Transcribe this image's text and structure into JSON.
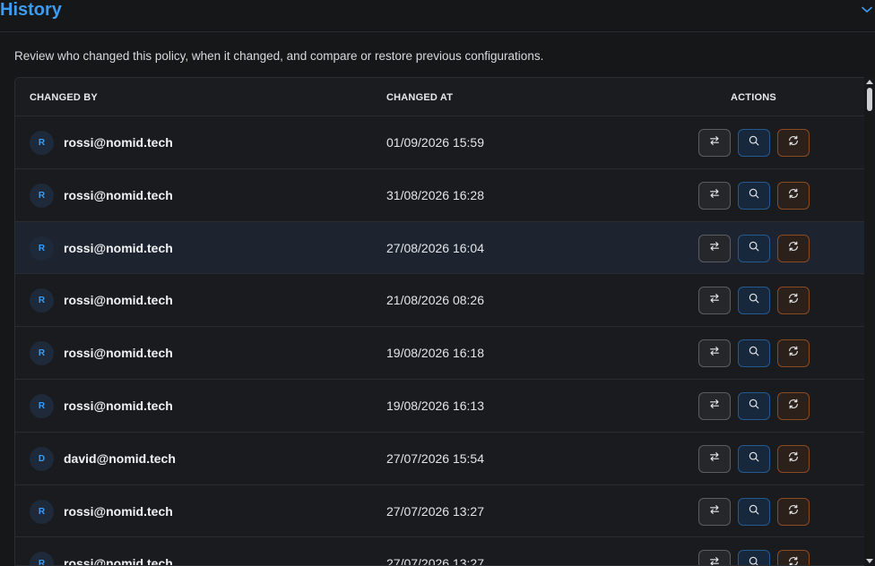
{
  "section": {
    "title": "History",
    "description": "Review who changed this policy, when it changed, and compare or restore previous configurations."
  },
  "table": {
    "headers": {
      "changed_by": "CHANGED BY",
      "changed_at": "CHANGED AT",
      "actions": "ACTIONS"
    },
    "rows": [
      {
        "initial": "R",
        "user": "rossi@nomid.tech",
        "changed_at": "01/09/2026 15:59"
      },
      {
        "initial": "R",
        "user": "rossi@nomid.tech",
        "changed_at": "31/08/2026 16:28"
      },
      {
        "initial": "R",
        "user": "rossi@nomid.tech",
        "changed_at": "27/08/2026 16:04"
      },
      {
        "initial": "R",
        "user": "rossi@nomid.tech",
        "changed_at": "21/08/2026 08:26"
      },
      {
        "initial": "R",
        "user": "rossi@nomid.tech",
        "changed_at": "19/08/2026 16:18"
      },
      {
        "initial": "R",
        "user": "rossi@nomid.tech",
        "changed_at": "19/08/2026 16:13"
      },
      {
        "initial": "D",
        "user": "david@nomid.tech",
        "changed_at": "27/07/2026 15:54"
      },
      {
        "initial": "R",
        "user": "rossi@nomid.tech",
        "changed_at": "27/07/2026 13:27"
      },
      {
        "initial": "R",
        "user": "rossi@nomid.tech",
        "changed_at": "27/07/2026 13:27"
      }
    ],
    "highlighted_row": 2
  },
  "icons": {
    "collapse": "chevron-down-icon",
    "compare": "arrows-swap-icon",
    "view": "search-icon",
    "restore": "refresh-icon"
  },
  "colors": {
    "accent": "#3d9cf0",
    "restore": "#e0783a",
    "background": "#161719"
  }
}
